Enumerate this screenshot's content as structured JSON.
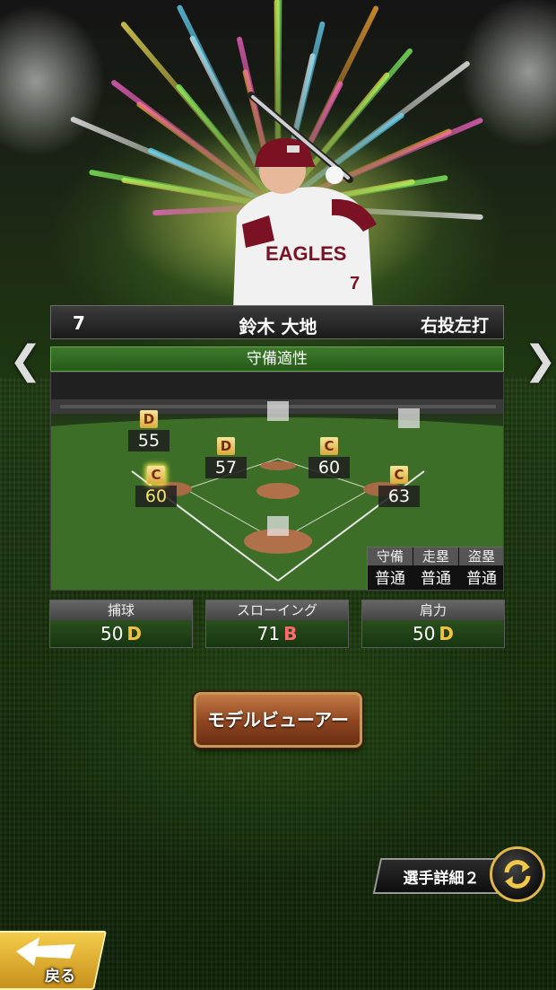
{
  "player": {
    "number": "7",
    "name": "鈴木 大地",
    "handedness": "右投左打"
  },
  "nav": {
    "prev_icon": "chevron-left-icon",
    "next_icon": "chevron-right-icon"
  },
  "section_title": "守備適性",
  "positions": [
    {
      "id": "left-field",
      "grade": "D",
      "value": "55",
      "highlight": false
    },
    {
      "id": "center-field",
      "grade": null,
      "value": null
    },
    {
      "id": "right-field",
      "grade": null,
      "value": null
    },
    {
      "id": "shortstop",
      "grade": "D",
      "value": "57",
      "highlight": false
    },
    {
      "id": "second-base",
      "grade": "C",
      "value": "60",
      "highlight": false
    },
    {
      "id": "third-base",
      "grade": "C",
      "value": "60",
      "highlight": true
    },
    {
      "id": "first-base",
      "grade": "C",
      "value": "63",
      "highlight": false
    },
    {
      "id": "catcher",
      "grade": null,
      "value": null
    }
  ],
  "abilities": {
    "headers": [
      "守備",
      "走塁",
      "盗塁"
    ],
    "values": [
      "普通",
      "普通",
      "普通"
    ]
  },
  "stats": [
    {
      "label": "捕球",
      "value": "50",
      "rank": "D",
      "rank_color": "#f3c23a"
    },
    {
      "label": "スローイング",
      "value": "71",
      "rank": "B",
      "rank_color": "#ff6a6a"
    },
    {
      "label": "肩力",
      "value": "50",
      "rank": "D",
      "rank_color": "#f3c23a"
    }
  ],
  "buttons": {
    "model_viewer": "モデルビューアー",
    "player_detail": "選手詳細２",
    "back": "戻る"
  },
  "colors": {
    "accent_green": "#3d7a2c",
    "gold": "#e0b84a"
  }
}
